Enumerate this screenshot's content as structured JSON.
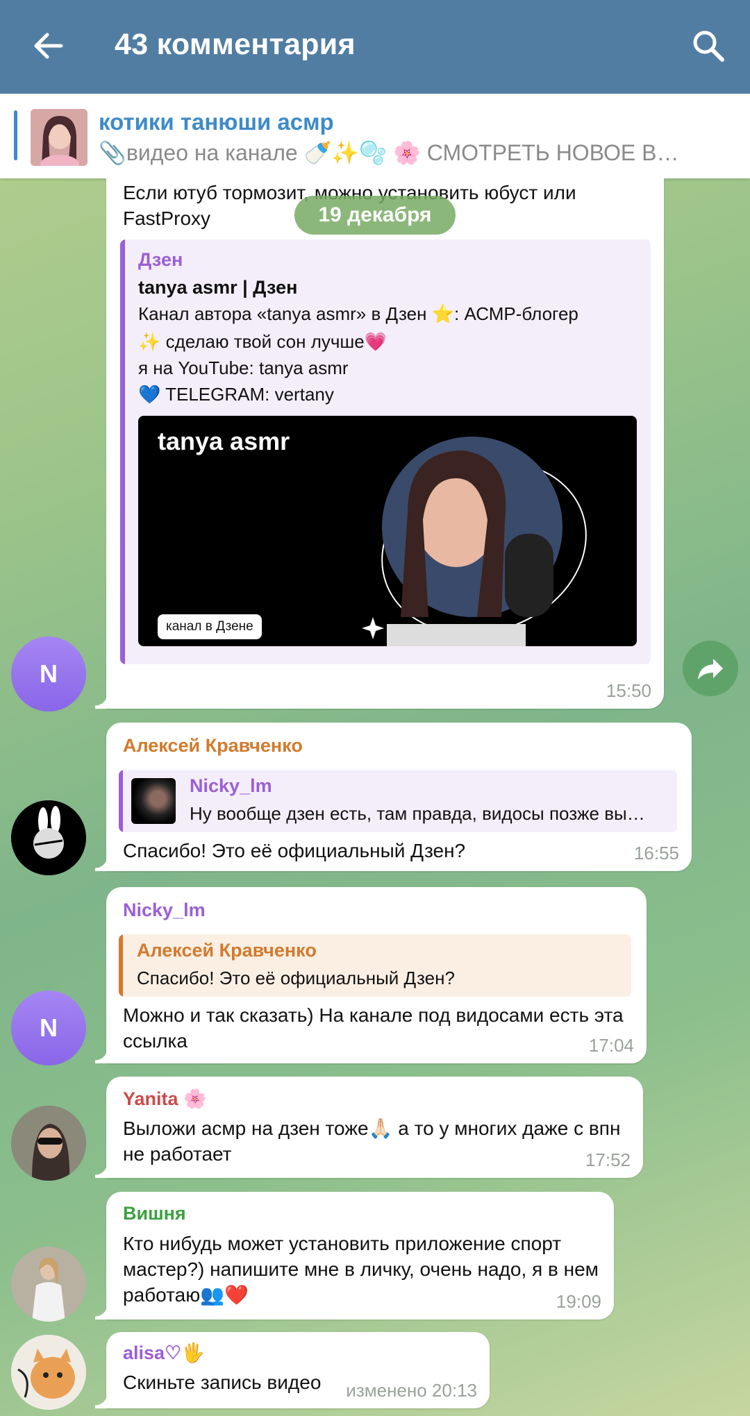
{
  "header": {
    "title": "43 комментария"
  },
  "pinned": {
    "name": "котики танюши асмр",
    "text": "видео на канале 🍼✨🫧 🌸   СМОТРЕТЬ НОВОЕ В…"
  },
  "date_pill": "19 декабря",
  "messages": [
    {
      "id": "m1",
      "text_top": "Если ютуб тормозит, можно установить юбуст или FastProxy",
      "preview": {
        "site": "Дзен",
        "title": "tanya asmr | Дзен",
        "desc_1": "Канал автора «tanya asmr» в Дзен ⭐: АСМР-блогер",
        "desc_2": "✨ сделаю твой сон лучше💗",
        "desc_3": "я на YouTube: tanya asmr",
        "desc_4": "💙 TELEGRAM: vertany",
        "image_title": "tanya asmr",
        "image_button": "канал в Дзене"
      },
      "time": "15:50",
      "avatar_letter": "N"
    },
    {
      "id": "m2",
      "sender": "Алексей Кравченко",
      "reply_name": "Nicky_lm",
      "reply_text": "Ну вообще дзен есть, там правда, видосы позже вы…",
      "text": "Спасибо! Это её официальный Дзен?",
      "time": "16:55"
    },
    {
      "id": "m3",
      "sender": "Nicky_lm",
      "reply_name": "Алексей Кравченко",
      "reply_text": "Спасибо! Это её официальный Дзен?",
      "text_1": "Можно и так сказать) На канале под видосами есть эта",
      "text_2": "ссылка",
      "time": "17:04",
      "avatar_letter": "N"
    },
    {
      "id": "m4",
      "sender": "Yanita 🌸",
      "text_1": "Выложи асмр на дзен тоже🙏🏻 а то у многих даже с впн",
      "text_2": "не работает",
      "time": "17:52"
    },
    {
      "id": "m5",
      "sender": "Вишня",
      "text_1": "Кто нибудь может установить приложение спорт",
      "text_2": "мастер?) напишите мне в личку, очень надо, я в нем",
      "text_3": "работаю👥❤️",
      "time": "19:09"
    },
    {
      "id": "m6",
      "sender": "alisa♡🖐",
      "text": "Скиньте запись видео",
      "time": "изменено 20:13"
    }
  ],
  "colors": {
    "header_bg": "#517da2",
    "link_blue": "#3d8bc9",
    "purple": "#9b5fd6",
    "orange": "#d27a2c",
    "red_name": "#cc4a4a",
    "green_name": "#3da042"
  }
}
